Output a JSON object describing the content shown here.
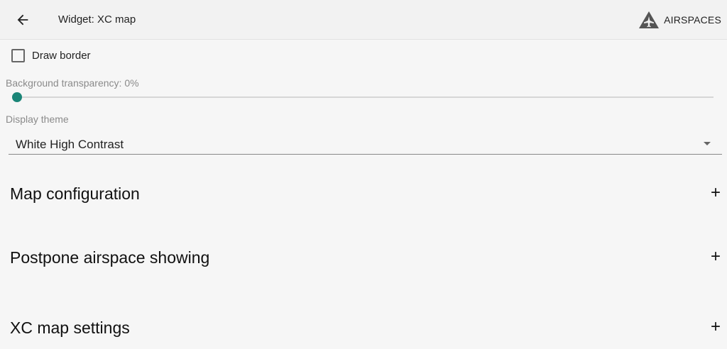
{
  "header": {
    "title": "Widget: XC map",
    "back_icon": "arrow-left-icon",
    "airspaces_label": "AIRSPACES",
    "airspaces_icon": "airspaces-logo-icon"
  },
  "settings": {
    "draw_border": {
      "label": "Draw border",
      "checked": false
    },
    "transparency": {
      "label": "Background transparency: 0%",
      "value_percent": 0
    },
    "display_theme": {
      "label": "Display theme",
      "value": "White High Contrast"
    }
  },
  "sections": [
    {
      "title": "Map configuration",
      "icon": "+"
    },
    {
      "title": "Postpone airspace showing",
      "icon": "+"
    },
    {
      "title": "XC map settings",
      "icon": "+"
    }
  ],
  "colors": {
    "accent": "#1a8577"
  }
}
